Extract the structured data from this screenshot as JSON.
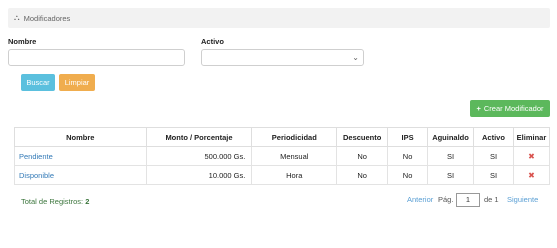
{
  "header": {
    "icon": "tags-icon",
    "title": "Modificadores"
  },
  "filters": {
    "nombre_label": "Nombre",
    "nombre_value": "",
    "activo_label": "Activo",
    "activo_value": ""
  },
  "buttons": {
    "buscar": "Buscar",
    "limpiar": "Limpiar",
    "crear": "Crear Modificador",
    "crear_icon": "plus-icon"
  },
  "table": {
    "columns": [
      "Nombre",
      "Monto / Porcentaje",
      "Periodicidad",
      "Descuento",
      "IPS",
      "Aguinaldo",
      "Activo",
      "Eliminar"
    ],
    "rows": [
      {
        "nombre": "Pendiente",
        "monto": "500.000 Gs.",
        "periodicidad": "Mensual",
        "descuento": "No",
        "ips": "No",
        "aguinaldo": "SI",
        "activo": "SI",
        "eliminar_icon": "delete-icon"
      },
      {
        "nombre": "Disponible",
        "monto": "10.000 Gs.",
        "periodicidad": "Hora",
        "descuento": "No",
        "ips": "No",
        "aguinaldo": "SI",
        "activo": "SI",
        "eliminar_icon": "delete-icon"
      }
    ]
  },
  "footer": {
    "total_label": "Total de Registros:",
    "total_value": "2",
    "anterior": "Anterior",
    "pag_label": "Pág.",
    "page_value": "1",
    "de_label": "de 1",
    "siguiente": "Siguiente"
  },
  "colors": {
    "info": "#5bc0de",
    "warning": "#f0ad4e",
    "success": "#5cb85c",
    "danger": "#d9534f",
    "link": "#337ab7"
  }
}
